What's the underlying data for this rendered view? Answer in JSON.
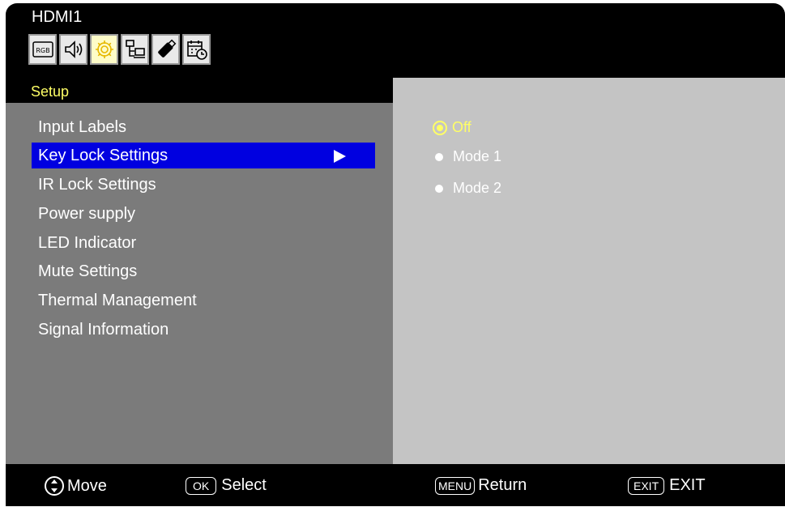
{
  "header": {
    "source": "HDMI1"
  },
  "tabs": [
    {
      "icon": "rgb-icon",
      "label": "RGB"
    },
    {
      "icon": "speaker-icon"
    },
    {
      "icon": "gear-icon",
      "active": true
    },
    {
      "icon": "network-icon"
    },
    {
      "icon": "usb-icon"
    },
    {
      "icon": "schedule-icon"
    }
  ],
  "section": {
    "title": "Setup"
  },
  "menu": {
    "items": [
      {
        "label": "Input Labels"
      },
      {
        "label": "Key Lock Settings",
        "selected": true
      },
      {
        "label": "IR Lock Settings"
      },
      {
        "label": "Power supply"
      },
      {
        "label": "LED Indicator"
      },
      {
        "label": "Mute Settings"
      },
      {
        "label": "Thermal Management"
      },
      {
        "label": "Signal Information"
      }
    ]
  },
  "options": {
    "items": [
      {
        "label": "Off",
        "selected": true
      },
      {
        "label": "Mode 1"
      },
      {
        "label": "Mode 2"
      }
    ]
  },
  "footer": {
    "move": "Move",
    "ok_key": "OK",
    "select": "Select",
    "menu_key": "MENU",
    "return": "Return",
    "exit_key": "EXIT",
    "exit": "EXIT"
  },
  "colors": {
    "highlight": "#0000e0",
    "accent": "#ffff66",
    "panel_left": "#7b7b7b",
    "panel_right": "#c4c4c4"
  }
}
